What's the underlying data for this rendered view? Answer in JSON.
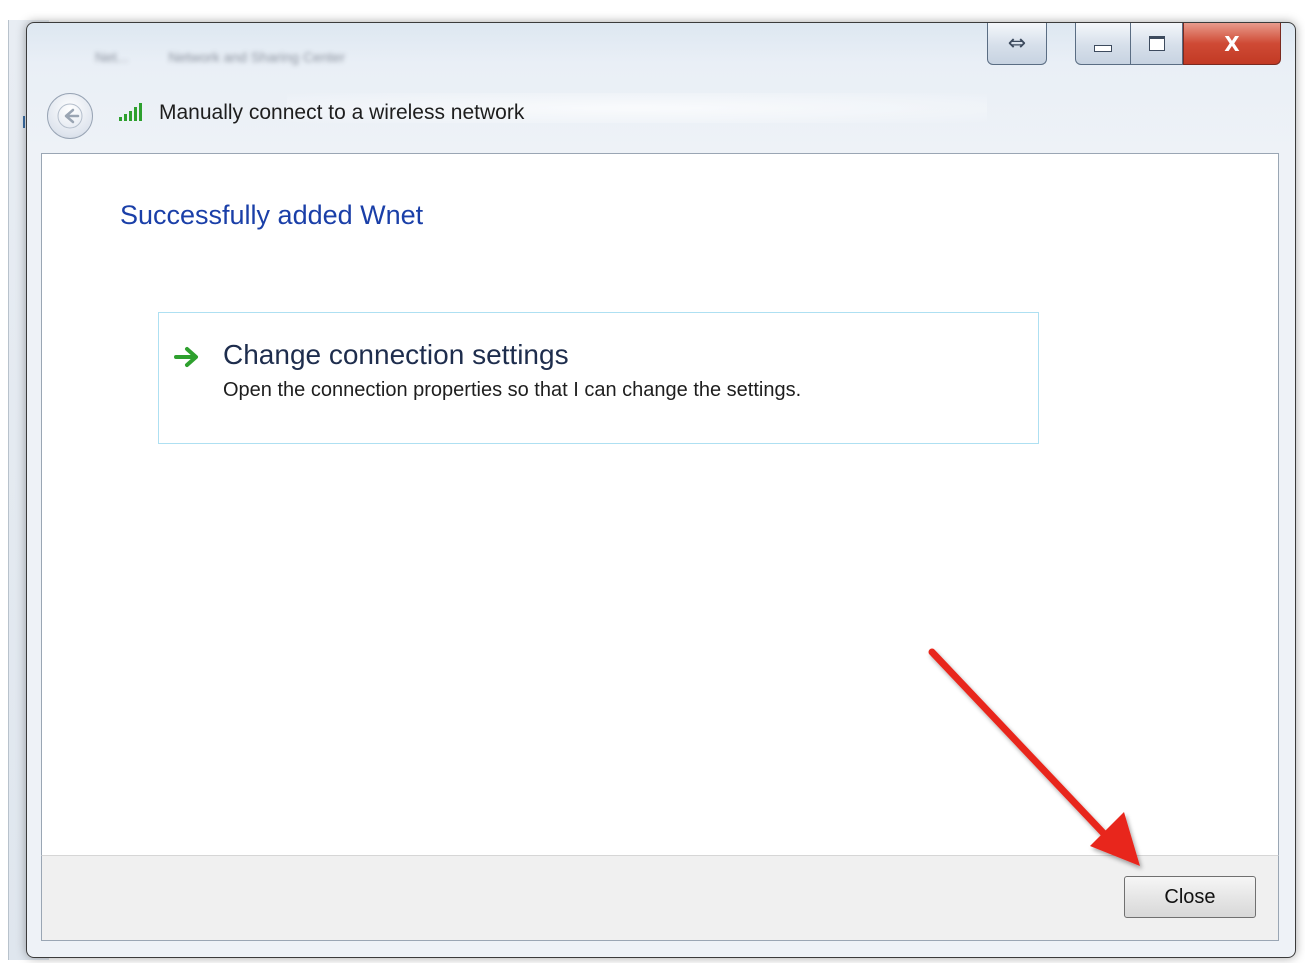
{
  "window": {
    "title_prefix": "Net...",
    "title_text": "Network and Sharing Center",
    "caption_buttons": {
      "resize_glyph": "⇔",
      "close_glyph": "X"
    }
  },
  "header": {
    "title": "Manually connect to a wireless network",
    "back_icon": "back-arrow-icon",
    "network_icon": "wireless-signal-icon"
  },
  "content": {
    "success_title": "Successfully added Wnet",
    "option": {
      "title": "Change connection settings",
      "description": "Open the connection properties so that I can change the settings.",
      "icon": "green-arrow-icon"
    }
  },
  "footer": {
    "close_label": "Close"
  },
  "colors": {
    "title_blue": "#1a3fa8",
    "card_border": "#aee0f2",
    "arrow_green": "#2ea02e",
    "annotation_red": "#e8281e",
    "close_caption_red": "#c23a24"
  }
}
